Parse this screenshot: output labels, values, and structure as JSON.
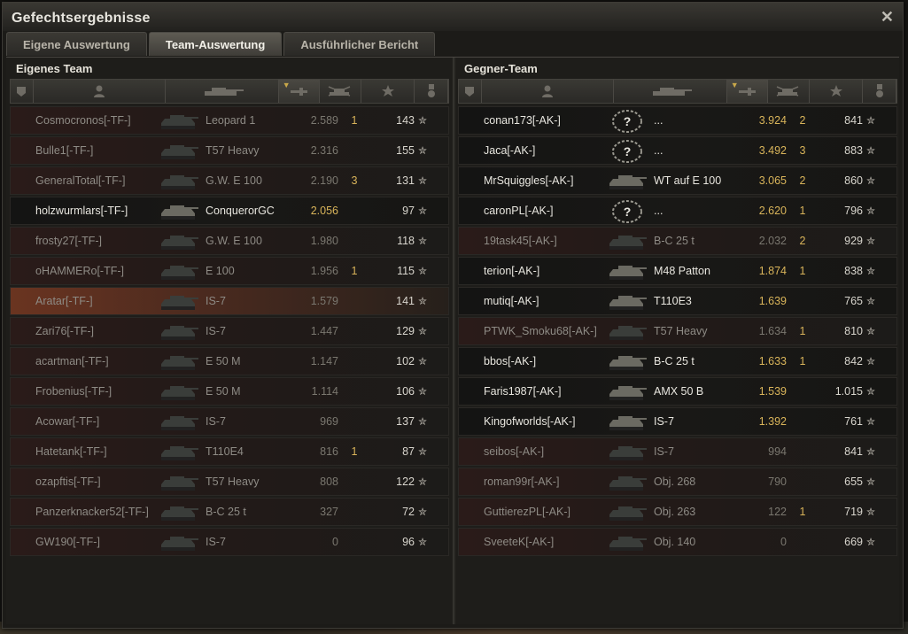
{
  "window": {
    "title": "Gefechtsergebnisse",
    "close_label": "✕"
  },
  "tabs": [
    {
      "label": "Eigene Auswertung",
      "active": false
    },
    {
      "label": "Team-Auswertung",
      "active": true
    },
    {
      "label": "Ausführlicher Bericht",
      "active": false
    }
  ],
  "own_team": {
    "title": "Eigenes Team",
    "rows": [
      {
        "player": "Cosmocronos[-TF-]",
        "tank": "Leopard 1",
        "damage": "2.589",
        "kills": "1",
        "xp": "143",
        "alive": false,
        "highlight": false
      },
      {
        "player": "Bulle1[-TF-]",
        "tank": "T57 Heavy",
        "damage": "2.316",
        "kills": "",
        "xp": "155",
        "alive": false,
        "highlight": false
      },
      {
        "player": "GeneralTotal[-TF-]",
        "tank": "G.W. E 100",
        "damage": "2.190",
        "kills": "3",
        "xp": "131",
        "alive": false,
        "highlight": false
      },
      {
        "player": "holzwurmlars[-TF-]",
        "tank": "ConquerorGC",
        "damage": "2.056",
        "kills": "",
        "xp": "97",
        "alive": true,
        "highlight": false
      },
      {
        "player": "frosty27[-TF-]",
        "tank": "G.W. E 100",
        "damage": "1.980",
        "kills": "",
        "xp": "118",
        "alive": false,
        "highlight": false
      },
      {
        "player": "oHAMMERo[-TF-]",
        "tank": "E 100",
        "damage": "1.956",
        "kills": "1",
        "xp": "115",
        "alive": false,
        "highlight": false
      },
      {
        "player": "Aratar[-TF-]",
        "tank": "IS-7",
        "damage": "1.579",
        "kills": "",
        "xp": "141",
        "alive": false,
        "highlight": true
      },
      {
        "player": "Zari76[-TF-]",
        "tank": "IS-7",
        "damage": "1.447",
        "kills": "",
        "xp": "129",
        "alive": false,
        "highlight": false
      },
      {
        "player": "acartman[-TF-]",
        "tank": "E 50 M",
        "damage": "1.147",
        "kills": "",
        "xp": "102",
        "alive": false,
        "highlight": false
      },
      {
        "player": "Frobenius[-TF-]",
        "tank": "E 50 M",
        "damage": "1.114",
        "kills": "",
        "xp": "106",
        "alive": false,
        "highlight": false
      },
      {
        "player": "Acowar[-TF-]",
        "tank": "IS-7",
        "damage": "969",
        "kills": "",
        "xp": "137",
        "alive": false,
        "highlight": false
      },
      {
        "player": "Hatetank[-TF-]",
        "tank": "T110E4",
        "damage": "816",
        "kills": "1",
        "xp": "87",
        "alive": false,
        "highlight": false
      },
      {
        "player": "ozapftis[-TF-]",
        "tank": "T57 Heavy",
        "damage": "808",
        "kills": "",
        "xp": "122",
        "alive": false,
        "highlight": false
      },
      {
        "player": "Panzerknacker52[-TF-]",
        "tank": "B-C 25 t",
        "damage": "327",
        "kills": "",
        "xp": "72",
        "alive": false,
        "highlight": false
      },
      {
        "player": "GW190[-TF-]",
        "tank": "IS-7",
        "damage": "0",
        "kills": "",
        "xp": "96",
        "alive": false,
        "highlight": false
      }
    ]
  },
  "enemy_team": {
    "title": "Gegner-Team",
    "rows": [
      {
        "player": "conan173[-AK-]",
        "tank": "...",
        "damage": "3.924",
        "kills": "2",
        "xp": "841",
        "alive": true,
        "unknown": true
      },
      {
        "player": "Jaca[-AK-]",
        "tank": "...",
        "damage": "3.492",
        "kills": "3",
        "xp": "883",
        "alive": true,
        "unknown": true
      },
      {
        "player": "MrSquiggles[-AK-]",
        "tank": "WT auf E 100",
        "damage": "3.065",
        "kills": "2",
        "xp": "860",
        "alive": true,
        "unknown": false
      },
      {
        "player": "caronPL[-AK-]",
        "tank": "...",
        "damage": "2.620",
        "kills": "1",
        "xp": "796",
        "alive": true,
        "unknown": true
      },
      {
        "player": "19task45[-AK-]",
        "tank": "B-C 25 t",
        "damage": "2.032",
        "kills": "2",
        "xp": "929",
        "alive": false,
        "unknown": false
      },
      {
        "player": "terion[-AK-]",
        "tank": "M48 Patton",
        "damage": "1.874",
        "kills": "1",
        "xp": "838",
        "alive": true,
        "unknown": false
      },
      {
        "player": "mutiq[-AK-]",
        "tank": "T110E3",
        "damage": "1.639",
        "kills": "",
        "xp": "765",
        "alive": true,
        "unknown": false
      },
      {
        "player": "PTWK_Smoku68[-AK-]",
        "tank": "T57 Heavy",
        "damage": "1.634",
        "kills": "1",
        "xp": "810",
        "alive": false,
        "unknown": false
      },
      {
        "player": "bbos[-AK-]",
        "tank": "B-C 25 t",
        "damage": "1.633",
        "kills": "1",
        "xp": "842",
        "alive": true,
        "unknown": false
      },
      {
        "player": "Faris1987[-AK-]",
        "tank": "AMX 50 B",
        "damage": "1.539",
        "kills": "",
        "xp": "1.015",
        "alive": true,
        "unknown": false
      },
      {
        "player": "Kingofworlds[-AK-]",
        "tank": "IS-7",
        "damage": "1.392",
        "kills": "",
        "xp": "761",
        "alive": true,
        "unknown": false
      },
      {
        "player": "seibos[-AK-]",
        "tank": "IS-7",
        "damage": "994",
        "kills": "",
        "xp": "841",
        "alive": false,
        "unknown": false
      },
      {
        "player": "roman99r[-AK-]",
        "tank": "Obj. 268",
        "damage": "790",
        "kills": "",
        "xp": "655",
        "alive": false,
        "unknown": false
      },
      {
        "player": "GuttierezPL[-AK-]",
        "tank": "Obj. 263",
        "damage": "122",
        "kills": "1",
        "xp": "719",
        "alive": false,
        "unknown": false
      },
      {
        "player": "SveeteK[-AK-]",
        "tank": "Obj. 140",
        "damage": "0",
        "kills": "",
        "xp": "669",
        "alive": false,
        "unknown": false
      }
    ]
  },
  "columns": [
    {
      "icon": "squad-icon"
    },
    {
      "icon": "player-icon"
    },
    {
      "icon": "tank-icon"
    },
    {
      "icon": "damage-icon",
      "sorted": true
    },
    {
      "icon": "kills-icon"
    },
    {
      "icon": "xp-star-icon"
    },
    {
      "icon": "medal-icon"
    }
  ],
  "colors": {
    "alive_text": "#e8e6df",
    "dead_text": "#8e8b85",
    "damage_alive": "#d9b45a",
    "kills": "#d9b45a",
    "dead_row": "#2a1b19",
    "highlight_row": "#6a3420"
  }
}
